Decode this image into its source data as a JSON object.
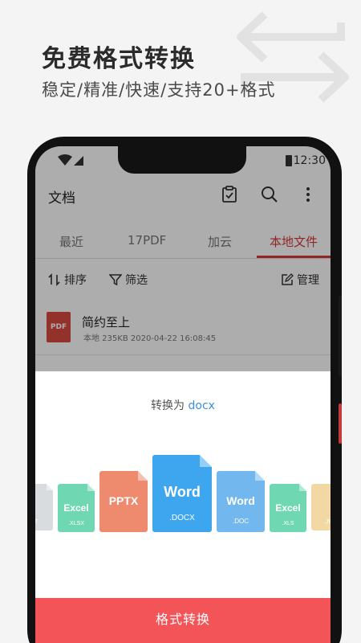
{
  "promo": {
    "title": "免费格式转换",
    "subtitle": "稳定/精准/快速/支持20+格式"
  },
  "statusbar": {
    "time": "12:30"
  },
  "appbar": {
    "title": "文档",
    "icons": [
      "clipboard-check-icon",
      "search-icon",
      "more-vertical-icon"
    ]
  },
  "tabs": [
    {
      "label": "最近"
    },
    {
      "label": "17PDF"
    },
    {
      "label": "加云"
    },
    {
      "label": "本地文件",
      "active": true
    }
  ],
  "toolbar": {
    "sort_label": "排序",
    "filter_label": "筛选",
    "manage_label": "管理"
  },
  "file": {
    "thumb_label": "PDF",
    "name": "简约至上",
    "meta": "本地  235KB  2020-04-22 16:08:45"
  },
  "sheet": {
    "title_prefix": "转换为 ",
    "target_format": "docx",
    "formats": [
      {
        "name": "",
        "ext": "T",
        "color": "#d9dcdf"
      },
      {
        "name": "Excel",
        "ext": ".XLSX",
        "color": "#6fd8b3"
      },
      {
        "name": "PPTX",
        "ext": "",
        "color": "#ee8a6d"
      },
      {
        "name": "Word",
        "ext": ".DOCX",
        "color": "#3ea6ee"
      },
      {
        "name": "Word",
        "ext": ".DOC",
        "color": "#72b8ee"
      },
      {
        "name": "Excel",
        "ext": ".XLS",
        "color": "#6fd8b3"
      },
      {
        "name": "",
        "ext": ".JP",
        "color": "#f2d9a4"
      }
    ],
    "button_label": "格式转换"
  },
  "colors": {
    "accent": "#d93636",
    "button": "#f25457",
    "link": "#3a8fdc"
  }
}
